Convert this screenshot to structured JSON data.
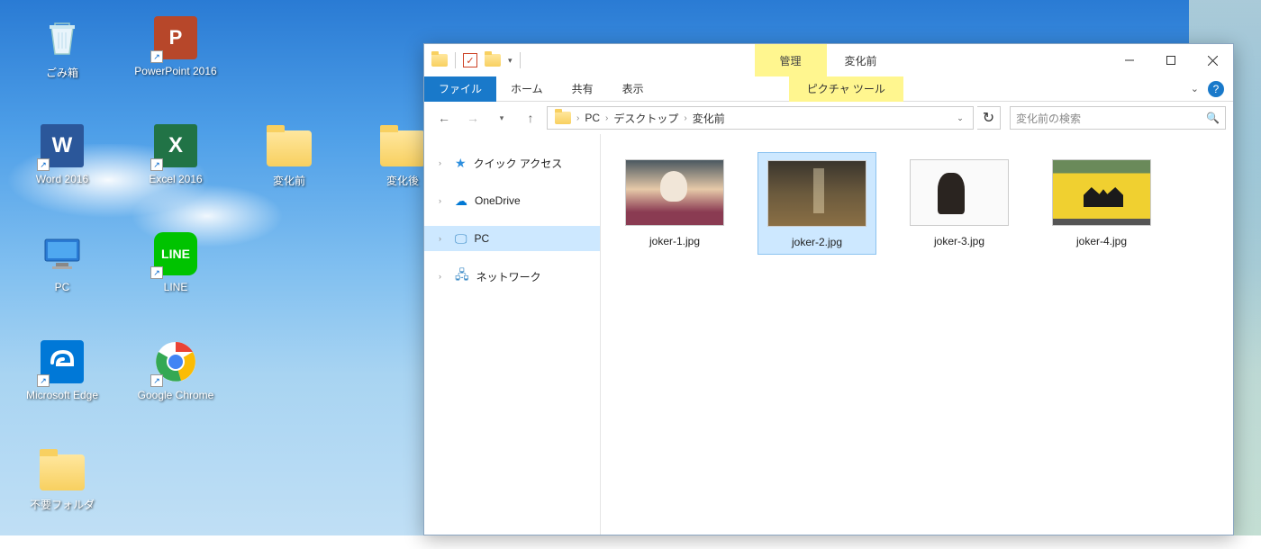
{
  "desktop": {
    "icons": [
      {
        "name": "recycle-bin",
        "label": "ごみ箱",
        "shortcut": false
      },
      {
        "name": "powerpoint",
        "label": "PowerPoint 2016",
        "shortcut": true
      },
      {
        "name": "blank",
        "label": ""
      },
      {
        "name": "blank",
        "label": ""
      },
      {
        "name": "word",
        "label": "Word 2016",
        "shortcut": true
      },
      {
        "name": "excel",
        "label": "Excel 2016",
        "shortcut": true
      },
      {
        "name": "folder-before",
        "label": "変化前",
        "shortcut": false
      },
      {
        "name": "folder-after",
        "label": "変化後",
        "shortcut": false
      },
      {
        "name": "pc",
        "label": "PC",
        "shortcut": false
      },
      {
        "name": "line",
        "label": "LINE",
        "shortcut": true
      },
      {
        "name": "blank",
        "label": ""
      },
      {
        "name": "blank",
        "label": ""
      },
      {
        "name": "edge",
        "label": "Microsoft Edge",
        "shortcut": true
      },
      {
        "name": "chrome",
        "label": "Google Chrome",
        "shortcut": true
      },
      {
        "name": "blank",
        "label": ""
      },
      {
        "name": "blank",
        "label": ""
      },
      {
        "name": "folder-unwanted",
        "label": "不要フォルダ",
        "shortcut": false
      }
    ]
  },
  "explorer": {
    "titlebar": {
      "context_label": "管理",
      "title": "変化前"
    },
    "ribbon": {
      "file": "ファイル",
      "home": "ホーム",
      "share": "共有",
      "view": "表示",
      "context_tab": "ピクチャ ツール"
    },
    "breadcrumb": [
      "PC",
      "デスクトップ",
      "変化前"
    ],
    "search_placeholder": "変化前の検索",
    "tree": [
      {
        "name": "quick-access",
        "label": "クイック アクセス",
        "icon": "star",
        "selected": false
      },
      {
        "name": "onedrive",
        "label": "OneDrive",
        "icon": "cloud",
        "selected": false
      },
      {
        "name": "pc",
        "label": "PC",
        "icon": "pc",
        "selected": true
      },
      {
        "name": "network",
        "label": "ネットワーク",
        "icon": "net",
        "selected": false
      }
    ],
    "files": [
      {
        "name": "joker-1",
        "label": "joker-1.jpg",
        "selected": false
      },
      {
        "name": "joker-2",
        "label": "joker-2.jpg",
        "selected": true
      },
      {
        "name": "joker-3",
        "label": "joker-3.jpg",
        "selected": false
      },
      {
        "name": "joker-4",
        "label": "joker-4.jpg",
        "selected": false
      }
    ]
  }
}
